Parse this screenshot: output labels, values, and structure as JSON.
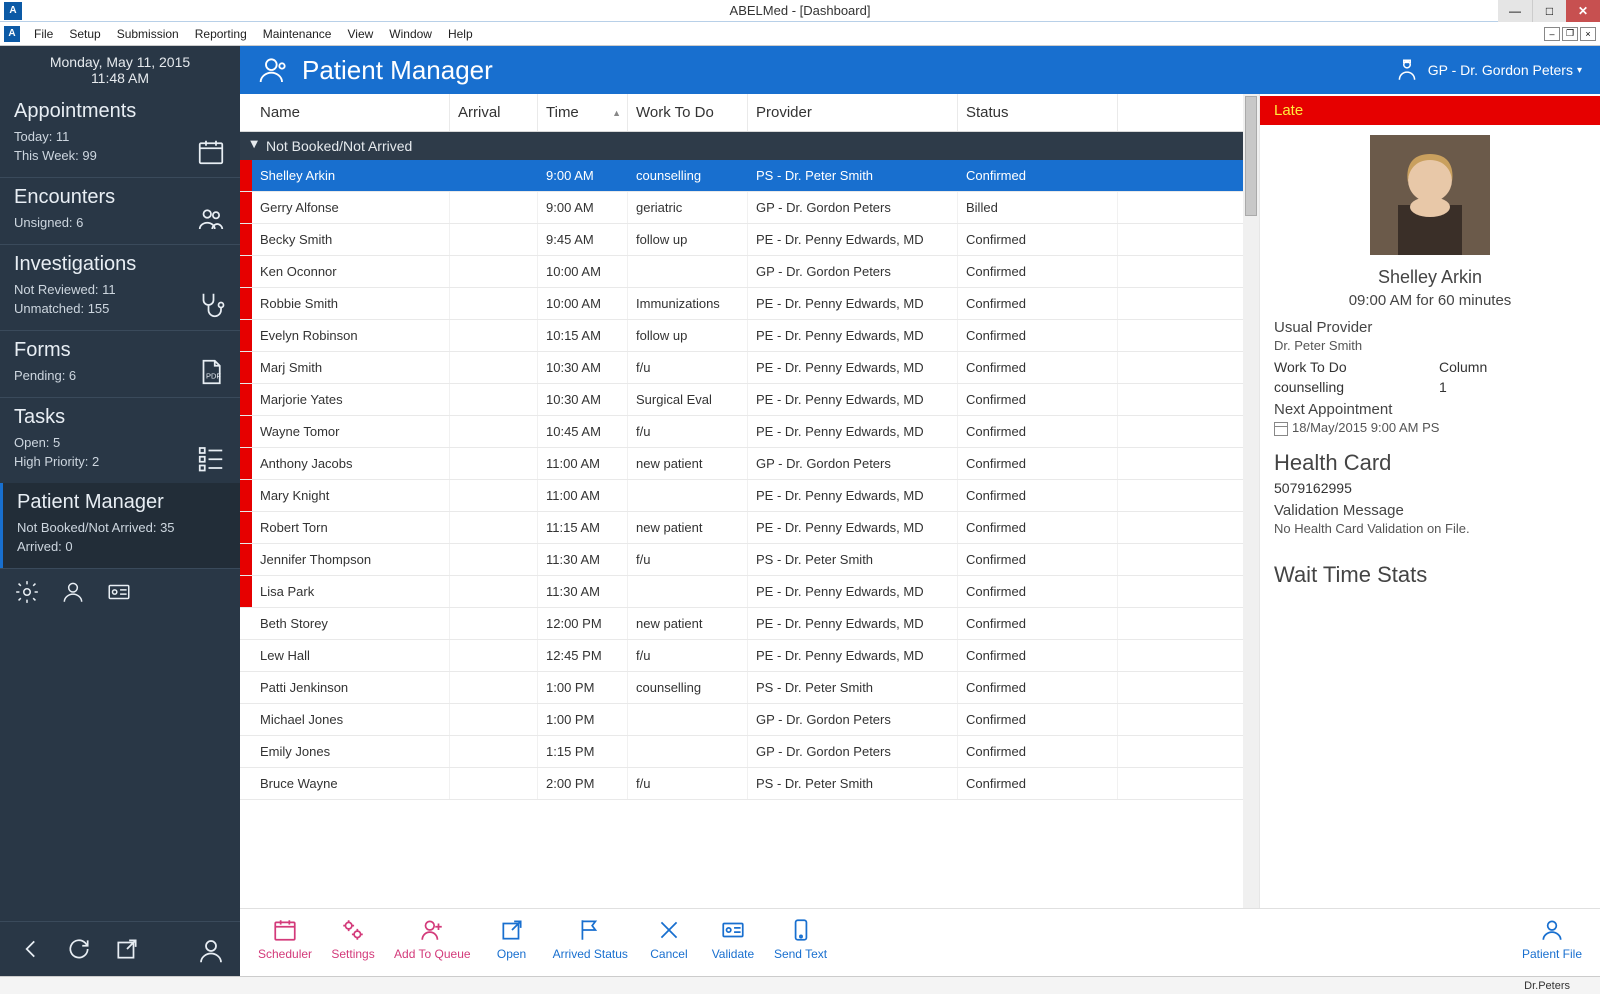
{
  "window": {
    "title": "ABELMed - [Dashboard]"
  },
  "menu": [
    "File",
    "Setup",
    "Submission",
    "Reporting",
    "Maintenance",
    "View",
    "Window",
    "Help"
  ],
  "sidebar": {
    "date": "Monday, May 11, 2015",
    "time": "11:48 AM",
    "appt": {
      "title": "Appointments",
      "l1": "Today: 11",
      "l2": "This Week: 99"
    },
    "enc": {
      "title": "Encounters",
      "l1": "Unsigned: 6"
    },
    "inv": {
      "title": "Investigations",
      "l1": "Not Reviewed: 11",
      "l2": "Unmatched: 155"
    },
    "forms": {
      "title": "Forms",
      "l1": "Pending: 6"
    },
    "tasks": {
      "title": "Tasks",
      "l1": "Open: 5",
      "l2": "High Priority: 2"
    },
    "pm": {
      "title": "Patient Manager",
      "l1": "Not Booked/Not Arrived: 35",
      "l2": "Arrived: 0"
    }
  },
  "header": {
    "title": "Patient Manager",
    "provider": "GP - Dr. Gordon Peters"
  },
  "columns": [
    "Name",
    "Arrival",
    "Time",
    "Work To Do",
    "Provider",
    "Status"
  ],
  "group": "Not Booked/Not Arrived",
  "rows": [
    {
      "late": true,
      "sel": true,
      "name": "Shelley Arkin",
      "arrival": "",
      "time": "9:00 AM",
      "work": "counselling",
      "prov": "PS - Dr. Peter Smith",
      "status": "Confirmed"
    },
    {
      "late": true,
      "name": "Gerry Alfonse",
      "arrival": "",
      "time": "9:00 AM",
      "work": "geriatric",
      "prov": "GP - Dr. Gordon Peters",
      "status": "Billed"
    },
    {
      "late": true,
      "name": "Becky Smith",
      "arrival": "",
      "time": "9:45 AM",
      "work": "follow up",
      "prov": "PE - Dr. Penny Edwards, MD",
      "status": "Confirmed"
    },
    {
      "late": true,
      "name": "Ken Oconnor",
      "arrival": "",
      "time": "10:00 AM",
      "work": "",
      "prov": "GP - Dr. Gordon Peters",
      "status": "Confirmed"
    },
    {
      "late": true,
      "name": "Robbie Smith",
      "arrival": "",
      "time": "10:00 AM",
      "work": "Immunizations",
      "prov": "PE - Dr. Penny Edwards, MD",
      "status": "Confirmed"
    },
    {
      "late": true,
      "name": "Evelyn Robinson",
      "arrival": "",
      "time": "10:15 AM",
      "work": "follow up",
      "prov": "PE - Dr. Penny Edwards, MD",
      "status": "Confirmed"
    },
    {
      "late": true,
      "name": "Marj Smith",
      "arrival": "",
      "time": "10:30 AM",
      "work": "f/u",
      "prov": "PE - Dr. Penny Edwards, MD",
      "status": "Confirmed"
    },
    {
      "late": true,
      "name": "Marjorie Yates",
      "arrival": "",
      "time": "10:30 AM",
      "work": "Surgical Eval",
      "prov": "PE - Dr. Penny Edwards, MD",
      "status": "Confirmed"
    },
    {
      "late": true,
      "name": "Wayne Tomor",
      "arrival": "",
      "time": "10:45 AM",
      "work": "f/u",
      "prov": "PE - Dr. Penny Edwards, MD",
      "status": "Confirmed"
    },
    {
      "late": true,
      "name": "Anthony Jacobs",
      "arrival": "",
      "time": "11:00 AM",
      "work": "new patient",
      "prov": "GP - Dr. Gordon Peters",
      "status": "Confirmed"
    },
    {
      "late": true,
      "name": "Mary Knight",
      "arrival": "",
      "time": "11:00 AM",
      "work": "",
      "prov": "PE - Dr. Penny Edwards, MD",
      "status": "Confirmed"
    },
    {
      "late": true,
      "name": "Robert Torn",
      "arrival": "",
      "time": "11:15 AM",
      "work": "new patient",
      "prov": "PE - Dr. Penny Edwards, MD",
      "status": "Confirmed"
    },
    {
      "late": true,
      "name": "Jennifer Thompson",
      "arrival": "",
      "time": "11:30 AM",
      "work": "f/u",
      "prov": "PS - Dr. Peter Smith",
      "status": "Confirmed"
    },
    {
      "late": true,
      "name": "Lisa Park",
      "arrival": "",
      "time": "11:30 AM",
      "work": "",
      "prov": "PE - Dr. Penny Edwards, MD",
      "status": "Confirmed"
    },
    {
      "late": false,
      "name": "Beth Storey",
      "arrival": "",
      "time": "12:00 PM",
      "work": "new patient",
      "prov": "PE - Dr. Penny Edwards, MD",
      "status": "Confirmed"
    },
    {
      "late": false,
      "name": "Lew Hall",
      "arrival": "",
      "time": "12:45 PM",
      "work": "f/u",
      "prov": "PE - Dr. Penny Edwards, MD",
      "status": "Confirmed"
    },
    {
      "late": false,
      "name": "Patti Jenkinson",
      "arrival": "",
      "time": "1:00 PM",
      "work": "counselling",
      "prov": "PS - Dr. Peter Smith",
      "status": "Confirmed"
    },
    {
      "late": false,
      "name": "Michael Jones",
      "arrival": "",
      "time": "1:00 PM",
      "work": "",
      "prov": "GP - Dr. Gordon Peters",
      "status": "Confirmed"
    },
    {
      "late": false,
      "name": "Emily Jones",
      "arrival": "",
      "time": "1:15 PM",
      "work": "",
      "prov": "GP - Dr. Gordon Peters",
      "status": "Confirmed"
    },
    {
      "late": false,
      "name": "Bruce Wayne",
      "arrival": "",
      "time": "2:00 PM",
      "work": "f/u",
      "prov": "PS - Dr. Peter Smith",
      "status": "Confirmed"
    }
  ],
  "details": {
    "late": "Late",
    "name": "Shelley Arkin",
    "time": "09:00 AM for 60 minutes",
    "usualProviderLbl": "Usual Provider",
    "usualProvider": "Dr. Peter Smith",
    "workLbl": "Work To Do",
    "work": "counselling",
    "columnLbl": "Column",
    "column": "1",
    "nextApptLbl": "Next Appointment",
    "nextAppt": "18/May/2015 9:00 AM PS",
    "hcardTitle": "Health Card",
    "hcard": "5079162995",
    "validationLbl": "Validation Message",
    "validation": "No Health Card Validation on File.",
    "waitTitle": "Wait Time Stats"
  },
  "toolbar": {
    "scheduler": "Scheduler",
    "settings": "Settings",
    "addqueue": "Add To Queue",
    "open": "Open",
    "arrived": "Arrived Status",
    "cancel": "Cancel",
    "validate": "Validate",
    "sendtext": "Send Text",
    "patientfile": "Patient File"
  },
  "status": "Dr.Peters"
}
